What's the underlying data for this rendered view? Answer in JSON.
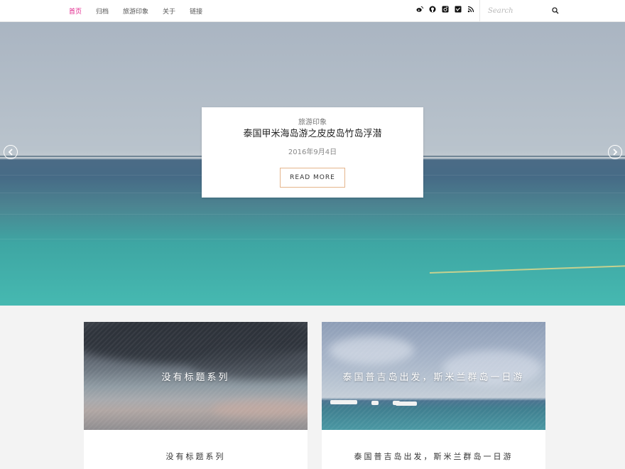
{
  "nav": {
    "items": [
      {
        "label": "首页",
        "active": true
      },
      {
        "label": "归档",
        "active": false
      },
      {
        "label": "旅游印象",
        "active": false
      },
      {
        "label": "关于",
        "active": false
      },
      {
        "label": "链接",
        "active": false
      }
    ],
    "active_color": "#e0218a"
  },
  "social": [
    "weibo-icon",
    "github-icon",
    "instagram-icon",
    "vimeo-icon",
    "rss-icon"
  ],
  "search": {
    "placeholder": "Search",
    "value": "",
    "icon": "search-icon"
  },
  "hero": {
    "category": "旅游印象",
    "title": "泰国甲米海岛游之皮皮岛竹岛浮潜",
    "date": "2016年9月4日",
    "button": "READ MORE",
    "button_border_color": "#e5b58c",
    "prev_icon": "chevron-left-icon",
    "next_icon": "chevron-right-icon"
  },
  "cards": [
    {
      "image_title": "没有标题系列",
      "title": "没有标题系列"
    },
    {
      "image_title": "泰国普吉岛出发，斯米兰群岛一日游",
      "title": "泰国普吉岛出发，斯米兰群岛一日游"
    }
  ]
}
